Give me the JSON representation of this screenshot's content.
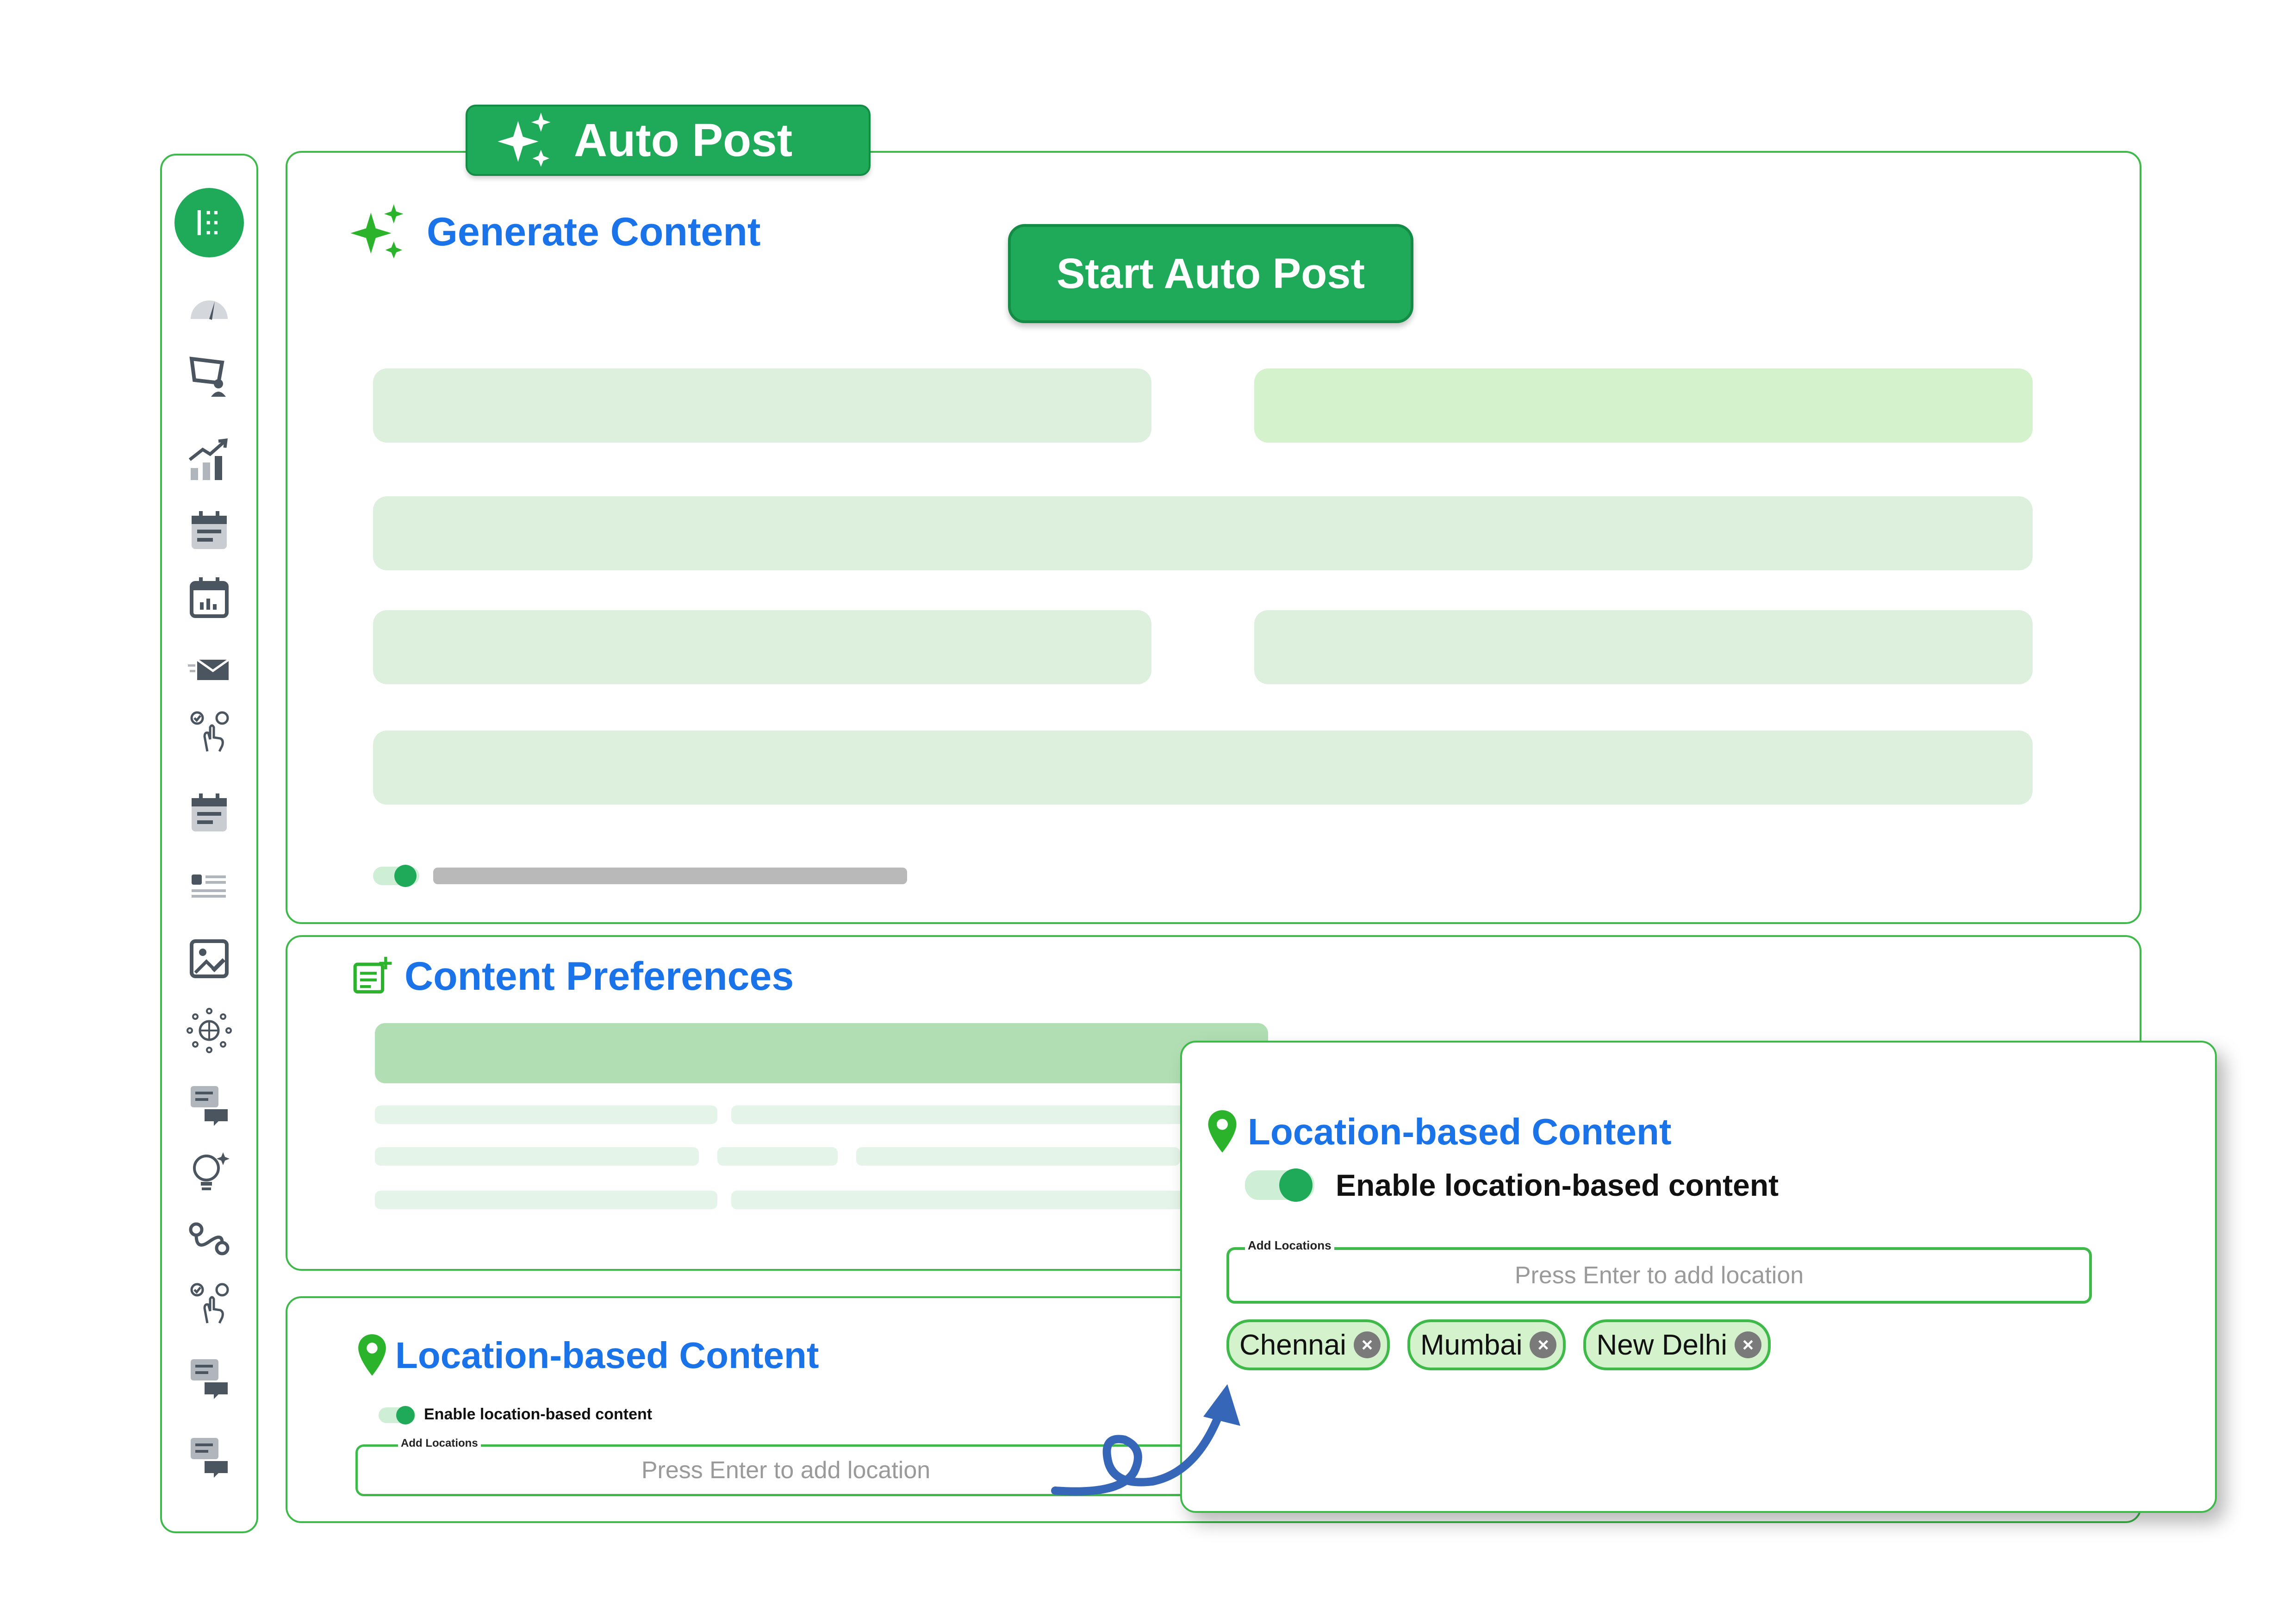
{
  "colors": {
    "brand_green": "#1faa5a",
    "border_green": "#3fb94a",
    "title_blue": "#1a73e8",
    "placeholder_green": "#dcf0dd",
    "icon_gray": "#5f6b75"
  },
  "header_tag": {
    "label": "Auto Post",
    "icon": "sparkles-icon"
  },
  "generate": {
    "title": "Generate Content",
    "icon": "sparkles-icon",
    "start_button": "Start Auto Post"
  },
  "preferences": {
    "title": "Content Preferences",
    "icon": "note-add-icon"
  },
  "location_section": {
    "title": "Location-based Content",
    "icon": "location-pin-icon",
    "toggle_label": "Enable location-based content",
    "toggle_on": true,
    "input_legend": "Add Locations",
    "input_placeholder": "Press Enter to add location"
  },
  "popup": {
    "title": "Location-based Content",
    "icon": "location-pin-icon",
    "toggle_label": "Enable location-based content",
    "toggle_on": true,
    "input_legend": "Add Locations",
    "input_placeholder": "Press Enter to add location",
    "chips": [
      "Chennai",
      "Mumbai",
      "New Delhi"
    ]
  },
  "sidebar": {
    "items": [
      "grid-menu-icon",
      "gauge-icon",
      "user-board-icon",
      "growth-chart-icon",
      "calendar-list-icon",
      "calendar-stats-icon",
      "mail-send-icon",
      "tap-check-icon",
      "calendar-list-icon",
      "list-layout-icon",
      "image-edit-icon",
      "network-globe-icon",
      "chat-icon",
      "idea-bulb-icon",
      "route-icon",
      "tap-check-icon",
      "chat-icon",
      "chat-icon"
    ]
  }
}
